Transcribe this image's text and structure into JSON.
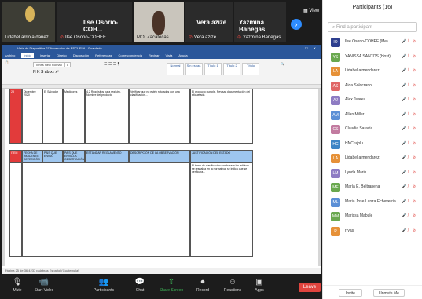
{
  "gallery": {
    "tile1": "Lidabel arriola danez",
    "tile2_big": "Ilse Osorio-COH...",
    "tile2": "Ilse Osorio-COHEF",
    "tile3": "MO. Zacatecas",
    "tile4_big": "Vera azize",
    "tile4": "Vera azize",
    "tile5_big": "Yazmina Banegas",
    "tile5": "Yazmina Banegas",
    "view": "View"
  },
  "word": {
    "title": "Vista de Diapositiva 07 Accesorios de ESCUELA - Guardado",
    "tabs": [
      "Archivo",
      "Inicio",
      "Insertar",
      "Diseño",
      "Disposición",
      "Referencias",
      "Correspondencia",
      "Revisar",
      "Vista",
      "Ayuda"
    ],
    "styles": [
      "Normal",
      "Sin espac.",
      "Título 1",
      "Título 2",
      "Título"
    ],
    "font": "Times New Roman",
    "size": "8",
    "row1": {
      "c1": "28",
      "c2": "Diciembre 2020",
      "c3": "El Salvador",
      "c4": "Medidores",
      "c5": "4.2 Requisitos para registro. Nombre del producto",
      "c6": "Verificar que no estén rotulados con una clasificación...",
      "c7": "El producto cumple. Revisar documentación del etiquetado."
    },
    "headers": [
      "ITEM",
      "FECHA DE INCIDENTE DETECCIÓN",
      "PAIS QUE ENVIA",
      "PAIS QUE ENVIA LA OBSERVACIÓN",
      "ESTÁNDAR REGLAMENTO",
      "DESCRIPCIÓN DE LA OBSERVACIÓN",
      "JUSTIFICACIÓN DEL ESTADO"
    ],
    "row2": "El tema de clasificación con base a los aditivos se respalda en la normativa; se indica que se verificara...",
    "status": "Página 25 de 36   4237 palabras   Español (Guatemala)"
  },
  "toolbar": {
    "mute": "Mute",
    "video": "Start Video",
    "participants": "Participants",
    "chat": "Chat",
    "share": "Share Screen",
    "record": "Record",
    "reactions": "Reactions",
    "apps": "Apps",
    "leave": "Leave"
  },
  "panel": {
    "title": "Participants (16)",
    "search": "Find a participant",
    "invite": "Invite",
    "mute_all": "Unmute Me",
    "people": [
      {
        "init": "IO",
        "name": "Ilse Osorio-COHEF (Me)",
        "color": "#2e3f8f"
      },
      {
        "init": "YS",
        "name": "YANISSA SANTOS (Host)",
        "color": "#6aa84f"
      },
      {
        "init": "LA",
        "name": "Lidabel almendarez",
        "color": "#e69138"
      },
      {
        "init": "AS",
        "name": "Aida Solorzano",
        "color": "#e06666"
      },
      {
        "init": "AJ",
        "name": "Alex Juarez",
        "color": "#8e7cc3"
      },
      {
        "init": "AM",
        "name": "Allan Miller",
        "color": "#5b8fd6"
      },
      {
        "init": "CS",
        "name": "Claudia Saravia",
        "color": "#c27ba0"
      },
      {
        "init": "HC",
        "name": "HNCrujolu",
        "color": "#3d85c6"
      },
      {
        "init": "LA",
        "name": "Lidabel almendarez",
        "color": "#e69138"
      },
      {
        "init": "LM",
        "name": "Lynda Marin",
        "color": "#8e7cc3"
      },
      {
        "init": "ME",
        "name": "María E. Beltranena",
        "color": "#6aa84f"
      },
      {
        "init": "ML",
        "name": "Maria Jose Lanza Echeverria",
        "color": "#5b8fd6"
      },
      {
        "init": "MM",
        "name": "Marissa Mabule",
        "color": "#6aa84f"
      },
      {
        "init": "R",
        "name": "rryas",
        "color": "#e69138"
      }
    ]
  }
}
